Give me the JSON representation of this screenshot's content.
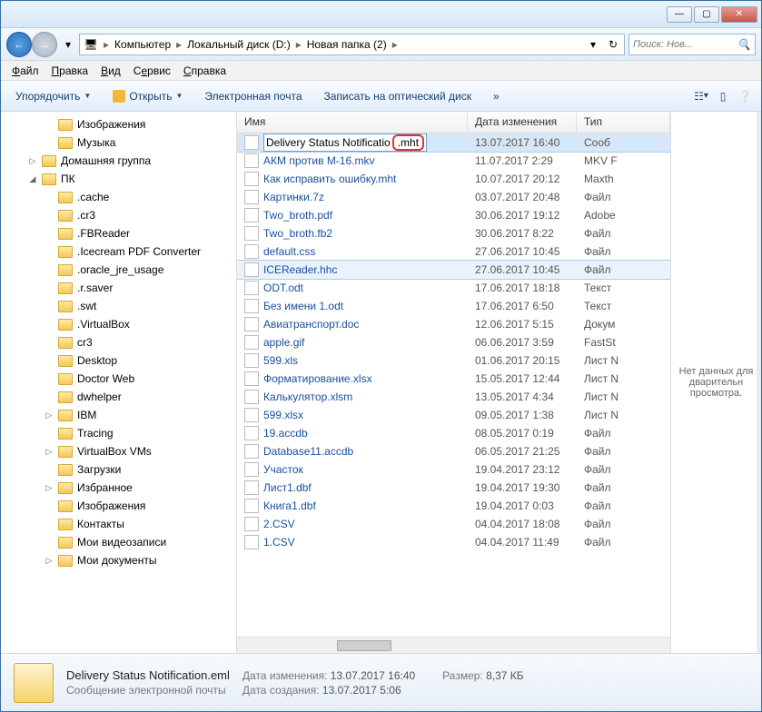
{
  "titlebar": {
    "min": "—",
    "max": "▢",
    "close": "✕"
  },
  "nav": {
    "back": "←",
    "fwd": "→",
    "crumbs": [
      "Компьютер",
      "Локальный диск (D:)",
      "Новая папка (2)"
    ],
    "search_placeholder": "Поиск: Нов..."
  },
  "menu": [
    "Файл",
    "Правка",
    "Вид",
    "Сервис",
    "Справка"
  ],
  "toolbar": {
    "organize": "Упорядочить",
    "open": "Открыть",
    "email": "Электронная почта",
    "burn": "Записать на оптический диск",
    "more": "»"
  },
  "tree": [
    {
      "label": "Изображения",
      "indent": 40,
      "icon": "pic"
    },
    {
      "label": "Музыка",
      "indent": 40,
      "icon": "music"
    },
    {
      "label": "Домашняя группа",
      "indent": 22,
      "icon": "home",
      "exp": "▷"
    },
    {
      "label": "ПК",
      "indent": 22,
      "icon": "pc",
      "exp": "◢"
    },
    {
      "label": ".cache",
      "indent": 40,
      "icon": "folder"
    },
    {
      "label": ".cr3",
      "indent": 40,
      "icon": "folder"
    },
    {
      "label": ".FBReader",
      "indent": 40,
      "icon": "folder"
    },
    {
      "label": ".Icecream PDF Converter",
      "indent": 40,
      "icon": "folder"
    },
    {
      "label": ".oracle_jre_usage",
      "indent": 40,
      "icon": "folder"
    },
    {
      "label": ".r.saver",
      "indent": 40,
      "icon": "folder"
    },
    {
      "label": ".swt",
      "indent": 40,
      "icon": "folder"
    },
    {
      "label": ".VirtualBox",
      "indent": 40,
      "icon": "folder"
    },
    {
      "label": "cr3",
      "indent": 40,
      "icon": "folder"
    },
    {
      "label": "Desktop",
      "indent": 40,
      "icon": "folder"
    },
    {
      "label": "Doctor Web",
      "indent": 40,
      "icon": "folder"
    },
    {
      "label": "dwhelper",
      "indent": 40,
      "icon": "folder"
    },
    {
      "label": "IBM",
      "indent": 40,
      "icon": "folder",
      "exp": "▷"
    },
    {
      "label": "Tracing",
      "indent": 40,
      "icon": "folder"
    },
    {
      "label": "VirtualBox VMs",
      "indent": 40,
      "icon": "folder",
      "exp": "▷"
    },
    {
      "label": "Загрузки",
      "indent": 40,
      "icon": "folder"
    },
    {
      "label": "Избранное",
      "indent": 40,
      "icon": "fav",
      "exp": "▷"
    },
    {
      "label": "Изображения",
      "indent": 40,
      "icon": "folder"
    },
    {
      "label": "Контакты",
      "indent": 40,
      "icon": "contacts"
    },
    {
      "label": "Мои видеозаписи",
      "indent": 40,
      "icon": "folder"
    },
    {
      "label": "Мои документы",
      "indent": 40,
      "icon": "folder",
      "exp": "▷"
    }
  ],
  "columns": {
    "name": "Имя",
    "date": "Дата изменения",
    "type": "Тип"
  },
  "files": [
    {
      "name_edit": "Delivery Status Notificatio",
      "ext_high": ".mht",
      "date": "13.07.2017 16:40",
      "type": "Сооб",
      "sel": true,
      "ic": "msg"
    },
    {
      "name": "АКМ против М-16.mkv",
      "date": "11.07.2017 2:29",
      "type": "MKV F",
      "ic": "vid"
    },
    {
      "name": "Как исправить ошибку.mht",
      "date": "10.07.2017 20:12",
      "type": "Maxth",
      "ic": "web"
    },
    {
      "name": "Картинки.7z",
      "date": "03.07.2017 20:48",
      "type": "Файл",
      "ic": "arc"
    },
    {
      "name": "Two_broth.pdf",
      "date": "30.06.2017 19:12",
      "type": "Adobe",
      "ic": "pdf"
    },
    {
      "name": "Two_broth.fb2",
      "date": "30.06.2017 8:22",
      "type": "Файл",
      "ic": "doc"
    },
    {
      "name": "default.css",
      "date": "27.06.2017 10:45",
      "type": "Файл",
      "ic": "css"
    },
    {
      "name": "ICEReader.hhc",
      "date": "27.06.2017 10:45",
      "type": "Файл",
      "ic": "doc",
      "hover": true
    },
    {
      "name": "ODT.odt",
      "date": "17.06.2017 18:18",
      "type": "Текст",
      "ic": "odt"
    },
    {
      "name": "Без имени 1.odt",
      "date": "17.06.2017 6:50",
      "type": "Текст",
      "ic": "odt"
    },
    {
      "name": "Авиатранспорт.doc",
      "date": "12.06.2017 5:15",
      "type": "Докум",
      "ic": "word"
    },
    {
      "name": "apple.gif",
      "date": "06.06.2017 3:59",
      "type": "FastSt",
      "ic": "img"
    },
    {
      "name": "599.xls",
      "date": "01.06.2017 20:15",
      "type": "Лист N",
      "ic": "xls"
    },
    {
      "name": "Форматирование.xlsx",
      "date": "15.05.2017 12:44",
      "type": "Лист N",
      "ic": "xls"
    },
    {
      "name": "Калькулятор.xlsm",
      "date": "13.05.2017 4:34",
      "type": "Лист N",
      "ic": "xls"
    },
    {
      "name": "599.xlsx",
      "date": "09.05.2017 1:38",
      "type": "Лист N",
      "ic": "xls"
    },
    {
      "name": "19.accdb",
      "date": "08.05.2017 0:19",
      "type": "Файл",
      "ic": "db"
    },
    {
      "name": "Database11.accdb",
      "date": "06.05.2017 21:25",
      "type": "Файл",
      "ic": "db"
    },
    {
      "name": "Участок",
      "date": "19.04.2017 23:12",
      "type": "Файл",
      "ic": "doc"
    },
    {
      "name": "Лист1.dbf",
      "date": "19.04.2017 19:30",
      "type": "Файл",
      "ic": "xls"
    },
    {
      "name": "Книга1.dbf",
      "date": "19.04.2017 0:03",
      "type": "Файл",
      "ic": "xls"
    },
    {
      "name": "2.CSV",
      "date": "04.04.2017 18:08",
      "type": "Файл",
      "ic": "xls"
    },
    {
      "name": "1.CSV",
      "date": "04.04.2017 11:49",
      "type": "Файл",
      "ic": "xls"
    }
  ],
  "preview": "Нет данных для дварительн просмотра.",
  "status": {
    "filename": "Delivery Status Notification.eml",
    "filetype": "Сообщение электронной почты",
    "mod_label": "Дата изменения:",
    "mod": "13.07.2017 16:40",
    "size_label": "Размер:",
    "size": "8,37 КБ",
    "created_label": "Дата создания:",
    "created": "13.07.2017 5:06"
  }
}
